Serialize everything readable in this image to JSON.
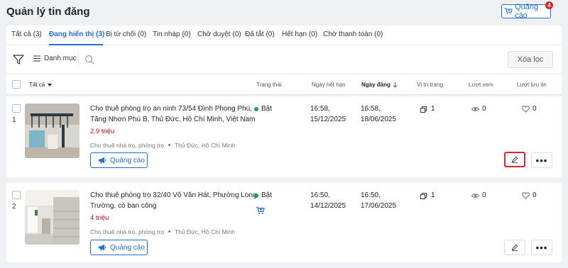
{
  "header": {
    "title": "Quản lý tin đăng",
    "ad_button_label": "Quảng cáo",
    "ad_badge_count": "4"
  },
  "tabs": [
    {
      "label": "Tất cả (3)",
      "active": false
    },
    {
      "label": "Đang hiển thị (3)",
      "active": true
    },
    {
      "label": "Bị từ chối (0)",
      "active": false
    },
    {
      "label": "Tin nháp (0)",
      "active": false
    },
    {
      "label": "Chờ duyệt (0)",
      "active": false
    },
    {
      "label": "Đã tắt (0)",
      "active": false
    },
    {
      "label": "Hết hạn (0)",
      "active": false
    },
    {
      "label": "Chờ thanh toán (0)",
      "active": false
    }
  ],
  "toolbar": {
    "category_label": "Danh mục",
    "clear_label": "Xóa lọc"
  },
  "table": {
    "columns": {
      "all": "Tất cả",
      "status": "Trạng thái",
      "expiry": "Ngày hết hạn",
      "posted": "Ngày đăng",
      "position": "Vị trí trang",
      "views": "Lượt xem",
      "saves": "Lượt lưu tin"
    },
    "rows": [
      {
        "num": "1",
        "title": "Cho thuê phòng trọ an ninh 73/54 Đình Phong Phú, Tăng Nhơn Phú B, Thủ Đức, Hồ Chí Minh, Việt Nam",
        "price": "2.9 triệu",
        "category": "Cho thuê nhà trọ, phòng trọ",
        "location": "Thủ Đức, Hồ Chí Minh",
        "ad_button": "Quảng cáo",
        "status": "Bật",
        "expiry_time": "16:58,",
        "expiry_date": "15/12/2025",
        "posted_time": "16:58,",
        "posted_date": "18/06/2025",
        "position": "1",
        "views": "0",
        "saves": "0"
      },
      {
        "num": "2",
        "title": "Cho thuê phòng trọ 32/40 Võ Văn Hát, Phường Long Trường, có ban công",
        "price": "4 triệu",
        "category": "Cho thuê nhà trọ, phòng trọ",
        "location": "Thủ Đức, Hồ Chí Minh",
        "ad_button": "Quảng cáo",
        "status": "Bật",
        "expiry_time": "16:50,",
        "expiry_date": "14/12/2025",
        "posted_time": "16:50,",
        "posted_date": "17/06/2025",
        "position": "1",
        "views": "0",
        "saves": "0"
      }
    ]
  },
  "colors": {
    "accent": "#1e6fd9",
    "price": "#d0021b",
    "status_on": "#17a34a",
    "highlight": "#e02424"
  }
}
